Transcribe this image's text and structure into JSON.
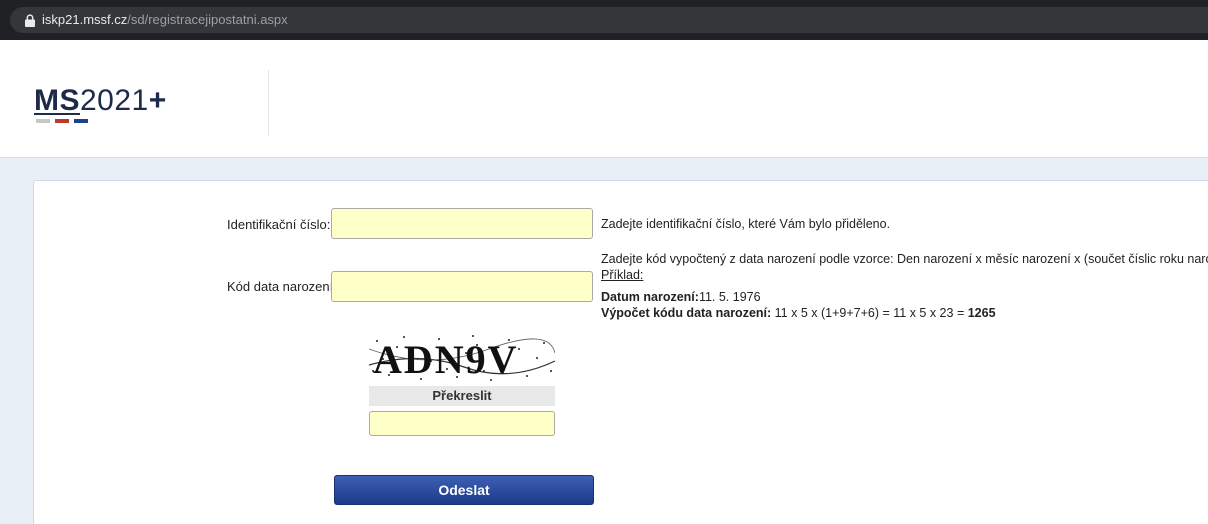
{
  "browser": {
    "url_host": "iskp21.mssf.cz",
    "url_path": "/sd/registracejipostatni.aspx"
  },
  "header": {
    "logo_ms": "MS",
    "logo_year": "2021",
    "logo_plus": "+",
    "logo_bar_colors": [
      "#c8c8c8",
      "#c0392b",
      "#1f3f8f"
    ]
  },
  "form": {
    "id_label": "Identifikační číslo:",
    "id_value": "",
    "id_hint": "Zadejte identifikační číslo, které Vám bylo přiděleno.",
    "birth_label": "Kód data narození",
    "birth_value": "",
    "birth_hint": "Zadejte kód vypočtený z data narození podle vzorce: Den narození x měsíc narození x (součet číslic roku narození).",
    "example_label": "Příklad:",
    "dob_label": "Datum narození:",
    "dob_value": "11. 5. 1976",
    "calc_label": "Výpočet kódu data narození:",
    "calc_value": " 11 x 5 x (1+9+7+6) = 11 x 5 x 23 = ",
    "calc_result": "1265",
    "captcha_text": "ADN9V",
    "redraw_label": "Překreslit",
    "captcha_value": "",
    "submit_label": "Odeslat"
  },
  "colors": {
    "input_bg": "#ffffc8",
    "button_blue": "#1c3a8a",
    "page_bg": "#e9eff7"
  }
}
